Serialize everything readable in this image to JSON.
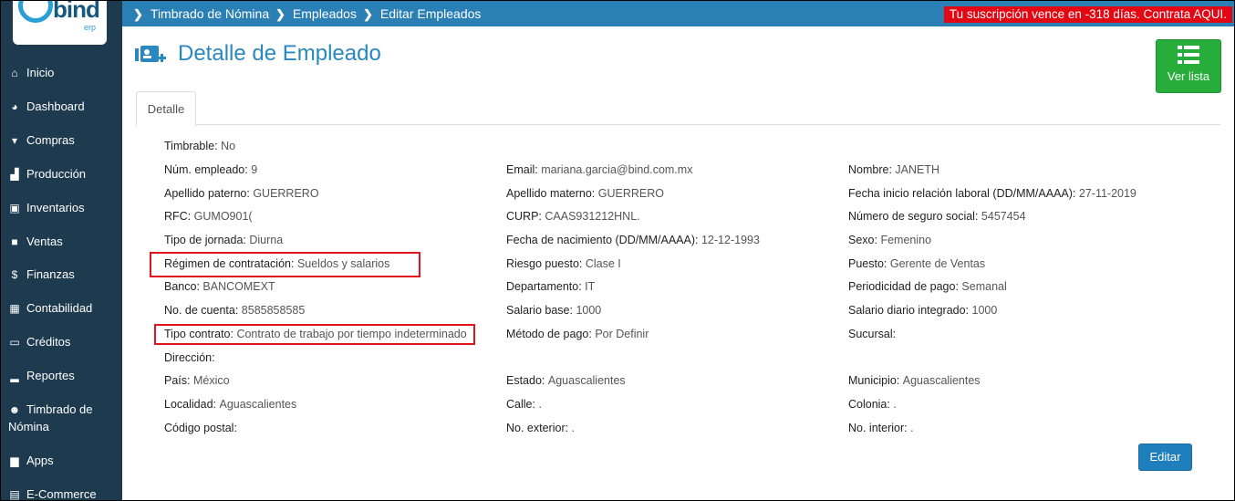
{
  "app": {
    "logo_word": "bind",
    "logo_sub": "erp"
  },
  "sidebar": {
    "items": [
      {
        "label": "Inicio",
        "icon": "home-icon"
      },
      {
        "label": "Dashboard",
        "icon": "dashboard-icon"
      },
      {
        "label": "Compras",
        "icon": "cart-icon"
      },
      {
        "label": "Producción",
        "icon": "industry-icon"
      },
      {
        "label": "Inventarios",
        "icon": "truck-icon"
      },
      {
        "label": "Ventas",
        "icon": "sales-icon"
      },
      {
        "label": "Finanzas",
        "icon": "dollar-icon"
      },
      {
        "label": "Contabilidad",
        "icon": "calculator-icon"
      },
      {
        "label": "Créditos",
        "icon": "credit-card-icon"
      },
      {
        "label": "Reportes",
        "icon": "bar-chart-icon"
      },
      {
        "label": "Timbrado de",
        "label2": "Nómina",
        "icon": "users-icon"
      },
      {
        "label": "Apps",
        "icon": "briefcase-icon"
      },
      {
        "label": "E-Commerce",
        "icon": "shop-icon"
      }
    ]
  },
  "breadcrumb": [
    "Timbrado de Nómina",
    "Empleados",
    "Editar Empleados"
  ],
  "subscription_alert": "Tu suscripción vence en -318 días. Contrata AQUI.",
  "header": {
    "title": "Detalle de Empleado",
    "ver_lista": "Ver lista"
  },
  "tabs": [
    "Detalle"
  ],
  "fields": {
    "timbrable": {
      "label": "Timbrable:",
      "value": "No"
    },
    "num_empleado": {
      "label": "Núm. empleado:",
      "value": "9"
    },
    "email": {
      "label": "Email:",
      "value": "mariana.garcia@bind.com.mx"
    },
    "nombre": {
      "label": "Nombre:",
      "value": "JANETH"
    },
    "apellido_paterno": {
      "label": "Apellido paterno:",
      "value": "GUERRERO"
    },
    "apellido_materno": {
      "label": "Apellido materno:",
      "value": "GUERRERO"
    },
    "fecha_inicio": {
      "label": "Fecha inicio relación laboral (DD/MM/AAAA):",
      "value": "27-11-2019"
    },
    "rfc": {
      "label": "RFC:",
      "value": "GUMO901("
    },
    "curp": {
      "label": "CURP:",
      "value": "CAAS931212HNL."
    },
    "nss": {
      "label": "Número de seguro social:",
      "value": "5457454"
    },
    "tipo_jornada": {
      "label": "Tipo de jornada:",
      "value": "Diurna"
    },
    "fecha_nacimiento": {
      "label": "Fecha de nacimiento (DD/MM/AAAA):",
      "value": "12-12-1993"
    },
    "sexo": {
      "label": "Sexo:",
      "value": "Femenino"
    },
    "regimen": {
      "label": "Régimen de contratación:",
      "value": "Sueldos y salarios"
    },
    "riesgo": {
      "label": "Riesgo puesto:",
      "value": "Clase I"
    },
    "puesto": {
      "label": "Puesto:",
      "value": "Gerente de Ventas"
    },
    "banco": {
      "label": "Banco:",
      "value": "BANCOMEXT"
    },
    "departamento": {
      "label": "Departamento:",
      "value": "IT"
    },
    "periodicidad": {
      "label": "Periodicidad de pago:",
      "value": "Semanal"
    },
    "cuenta": {
      "label": "No. de cuenta:",
      "value": "8585858585"
    },
    "salario_base": {
      "label": "Salario base:",
      "value": "1000"
    },
    "salario_diario": {
      "label": "Salario diario integrado:",
      "value": "1000"
    },
    "tipo_contrato": {
      "label": "Tipo contrato:",
      "value": "Contrato de trabajo por tiempo indeterminado"
    },
    "metodo_pago": {
      "label": "Método de pago:",
      "value": "Por Definir"
    },
    "sucursal": {
      "label": "Sucursal:",
      "value": ""
    },
    "direccion": {
      "label": "Dirección:",
      "value": ""
    },
    "pais": {
      "label": "País:",
      "value": "México"
    },
    "estado": {
      "label": "Estado:",
      "value": "Aguascalientes"
    },
    "municipio": {
      "label": "Municipio:",
      "value": "Aguascalientes"
    },
    "localidad": {
      "label": "Localidad:",
      "value": "Aguascalientes"
    },
    "calle": {
      "label": "Calle:",
      "value": "."
    },
    "colonia": {
      "label": "Colonia:",
      "value": "."
    },
    "codigo_postal": {
      "label": "Código postal:",
      "value": ""
    },
    "no_exterior": {
      "label": "No. exterior:",
      "value": "."
    },
    "no_interior": {
      "label": "No. interior:",
      "value": "."
    }
  },
  "actions": {
    "editar": "Editar"
  },
  "colors": {
    "sidebar": "#1e3a4f",
    "topbar": "#2a7fb4",
    "alert": "#e30613",
    "ver_lista": "#27ae3a",
    "editar": "#1f7fbd",
    "highlight": "#e0141c"
  }
}
